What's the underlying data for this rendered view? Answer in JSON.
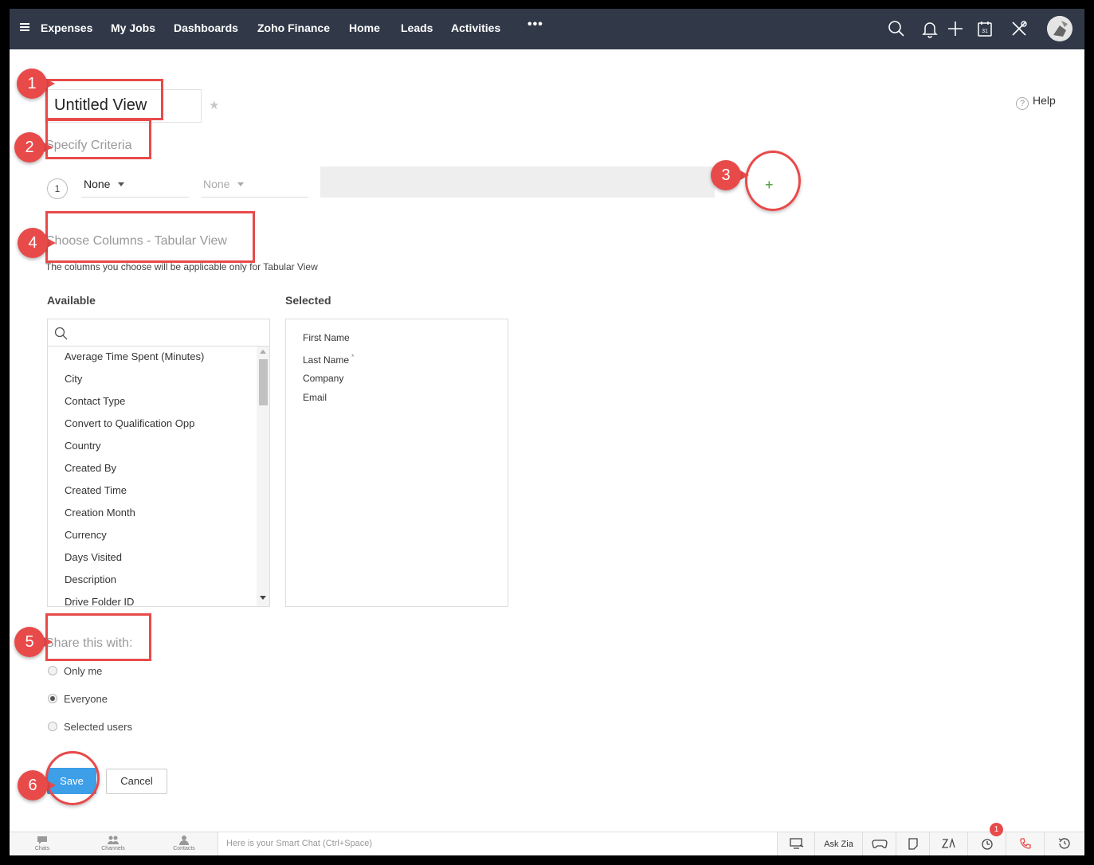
{
  "nav": {
    "items": [
      "Expenses",
      "My Jobs",
      "Dashboards",
      "Zoho Finance",
      "Home",
      "Leads",
      "Activities"
    ],
    "more": "•••",
    "calendar_day": "31"
  },
  "view": {
    "name": "Untitled View",
    "help": "Help",
    "help_glyph": "?"
  },
  "criteria": {
    "title": "Specify Criteria",
    "row_number": "1",
    "field": "None",
    "operator": "None",
    "add": "+"
  },
  "columns": {
    "title": "Choose Columns - Tabular View",
    "subtitle": "The columns you choose will be applicable only for Tabular View",
    "available_label": "Available",
    "selected_label": "Selected",
    "available": [
      "Average Time Spent (Minutes)",
      "City",
      "Contact Type",
      "Convert to Qualification Opp",
      "Country",
      "Created By",
      "Created Time",
      "Creation Month",
      "Currency",
      "Days Visited",
      "Description",
      "Drive Folder ID"
    ],
    "selected": [
      "First Name",
      "Last Name",
      "Company",
      "Email"
    ],
    "required_mark": "*"
  },
  "share": {
    "title": "Share this with:",
    "options": [
      "Only me",
      "Everyone",
      "Selected users"
    ],
    "selected": "Everyone"
  },
  "buttons": {
    "save": "Save",
    "cancel": "Cancel"
  },
  "bottom": {
    "chats": "Chats",
    "channels": "Channels",
    "contacts": "Contacts",
    "smartchat_placeholder": "Here is your Smart Chat (Ctrl+Space)",
    "ask_zia": "Ask Zia",
    "notification_count": "1"
  },
  "annotations": [
    "1",
    "2",
    "3",
    "4",
    "5",
    "6"
  ],
  "colors": {
    "nav_bg": "#313949",
    "accent": "#3d9fe8",
    "annotation": "#e84a4a"
  }
}
